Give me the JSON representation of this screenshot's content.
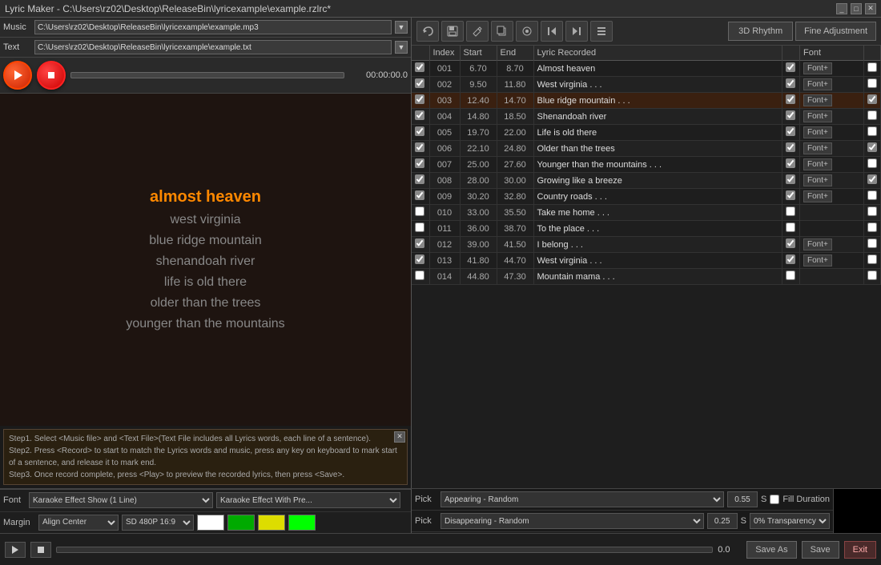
{
  "titleBar": {
    "title": "Lyric Maker - C:\\Users\\rz02\\Desktop\\ReleaseBin\\lyricexample\\example.rzlrc*",
    "minBtn": "_",
    "maxBtn": "□",
    "closeBtn": "✕"
  },
  "fileRow": {
    "musicLabel": "Music",
    "musicPath": "C:\\Users\\rz02\\Desktop\\ReleaseBin\\lyricexample\\example.mp3",
    "textLabel": "Text",
    "textPath": "C:\\Users\\rz02\\Desktop\\ReleaseBin\\lyricexample\\example.txt"
  },
  "transport": {
    "timeDisplay": "00:00:00.0"
  },
  "lyrics": [
    {
      "text": "almost heaven",
      "active": true
    },
    {
      "text": "west virginia",
      "active": false
    },
    {
      "text": "blue ridge mountain",
      "active": false
    },
    {
      "text": "shenandoah river",
      "active": false
    },
    {
      "text": "life is old there",
      "active": false
    },
    {
      "text": "older than the trees",
      "active": false
    },
    {
      "text": "younger than the mountains",
      "active": false
    }
  ],
  "infoSteps": [
    "Step1. Select <Music file> and <Text File>(Text File includes all Lyrics words, each line of a sentence).",
    "Step2. Press <Record> to start to match the Lyrics words and music, press any key on keyboard to mark start of a sentence, and release it to mark end.",
    "Step3. Once record complete, press <Play> to preview the recorded lyrics, then press <Save>."
  ],
  "toolbar": {
    "rhythmBtn": "3D Rhythm",
    "fineAdjBtn": "Fine Adjustment"
  },
  "table": {
    "headers": [
      "",
      "Index",
      "Start",
      "End",
      "Lyric Recorded",
      "",
      "Font",
      ""
    ],
    "rows": [
      {
        "checked": true,
        "index": "001",
        "start": "6.70",
        "end": "8.70",
        "lyric": "Almost heaven",
        "fontChecked": true,
        "extraChecked": false
      },
      {
        "checked": true,
        "index": "002",
        "start": "9.50",
        "end": "11.80",
        "lyric": "West virginia . . .",
        "fontChecked": true,
        "extraChecked": false
      },
      {
        "checked": true,
        "index": "003",
        "start": "12.40",
        "end": "14.70",
        "lyric": "Blue ridge mountain . . .",
        "fontChecked": true,
        "extraChecked": true,
        "highlight": true
      },
      {
        "checked": true,
        "index": "004",
        "start": "14.80",
        "end": "18.50",
        "lyric": "Shenandoah river",
        "fontChecked": true,
        "extraChecked": false
      },
      {
        "checked": true,
        "index": "005",
        "start": "19.70",
        "end": "22.00",
        "lyric": "Life is old there",
        "fontChecked": true,
        "extraChecked": false
      },
      {
        "checked": true,
        "index": "006",
        "start": "22.10",
        "end": "24.80",
        "lyric": "Older than the trees",
        "fontChecked": true,
        "extraChecked": true
      },
      {
        "checked": true,
        "index": "007",
        "start": "25.00",
        "end": "27.60",
        "lyric": "Younger than the mountains . . .",
        "fontChecked": true,
        "extraChecked": false
      },
      {
        "checked": true,
        "index": "008",
        "start": "28.00",
        "end": "30.00",
        "lyric": "Growing like a breeze",
        "fontChecked": true,
        "extraChecked": true
      },
      {
        "checked": true,
        "index": "009",
        "start": "30.20",
        "end": "32.80",
        "lyric": "Country roads . . .",
        "fontChecked": true,
        "extraChecked": false
      },
      {
        "checked": false,
        "index": "010",
        "start": "33.00",
        "end": "35.50",
        "lyric": "Take me home . . .",
        "fontChecked": false,
        "extraChecked": false
      },
      {
        "checked": false,
        "index": "011",
        "start": "36.00",
        "end": "38.70",
        "lyric": "To the place . . .",
        "fontChecked": false,
        "extraChecked": false
      },
      {
        "checked": true,
        "index": "012",
        "start": "39.00",
        "end": "41.50",
        "lyric": "I belong . . .",
        "fontChecked": true,
        "extraChecked": false
      },
      {
        "checked": true,
        "index": "013",
        "start": "41.80",
        "end": "44.70",
        "lyric": "West virginia . . .",
        "fontChecked": true,
        "extraChecked": false
      },
      {
        "checked": false,
        "index": "014",
        "start": "44.80",
        "end": "47.30",
        "lyric": "Mountain mama . . .",
        "fontChecked": false,
        "extraChecked": false
      }
    ]
  },
  "effectRow1": {
    "pickLabel": "Pick",
    "appearing": "Appearing - Random",
    "value": "0.55",
    "unit": "S",
    "fillDuration": "Fill Duration"
  },
  "effectRow2": {
    "pickLabel": "Pick",
    "disappearing": "Disappearing - Random",
    "value": "0.25",
    "unit": "S",
    "transparency": "0% Transparency"
  },
  "fontRow": {
    "label": "Font",
    "value": "Karaoke Effect Show (1 Line)",
    "value2": "Karaoke Effect With Pre..."
  },
  "marginRow": {
    "label": "Margin",
    "align": "Align Center",
    "resolution": "SD 480P 16:9",
    "colors": [
      "#ffffff",
      "#00aa00",
      "#dddd00",
      "#00ff00"
    ]
  },
  "bottomBar": {
    "timeDisplay": "0.0",
    "saveAsBtn": "Save As",
    "saveBtn": "Save",
    "exitBtn": "Exit"
  }
}
